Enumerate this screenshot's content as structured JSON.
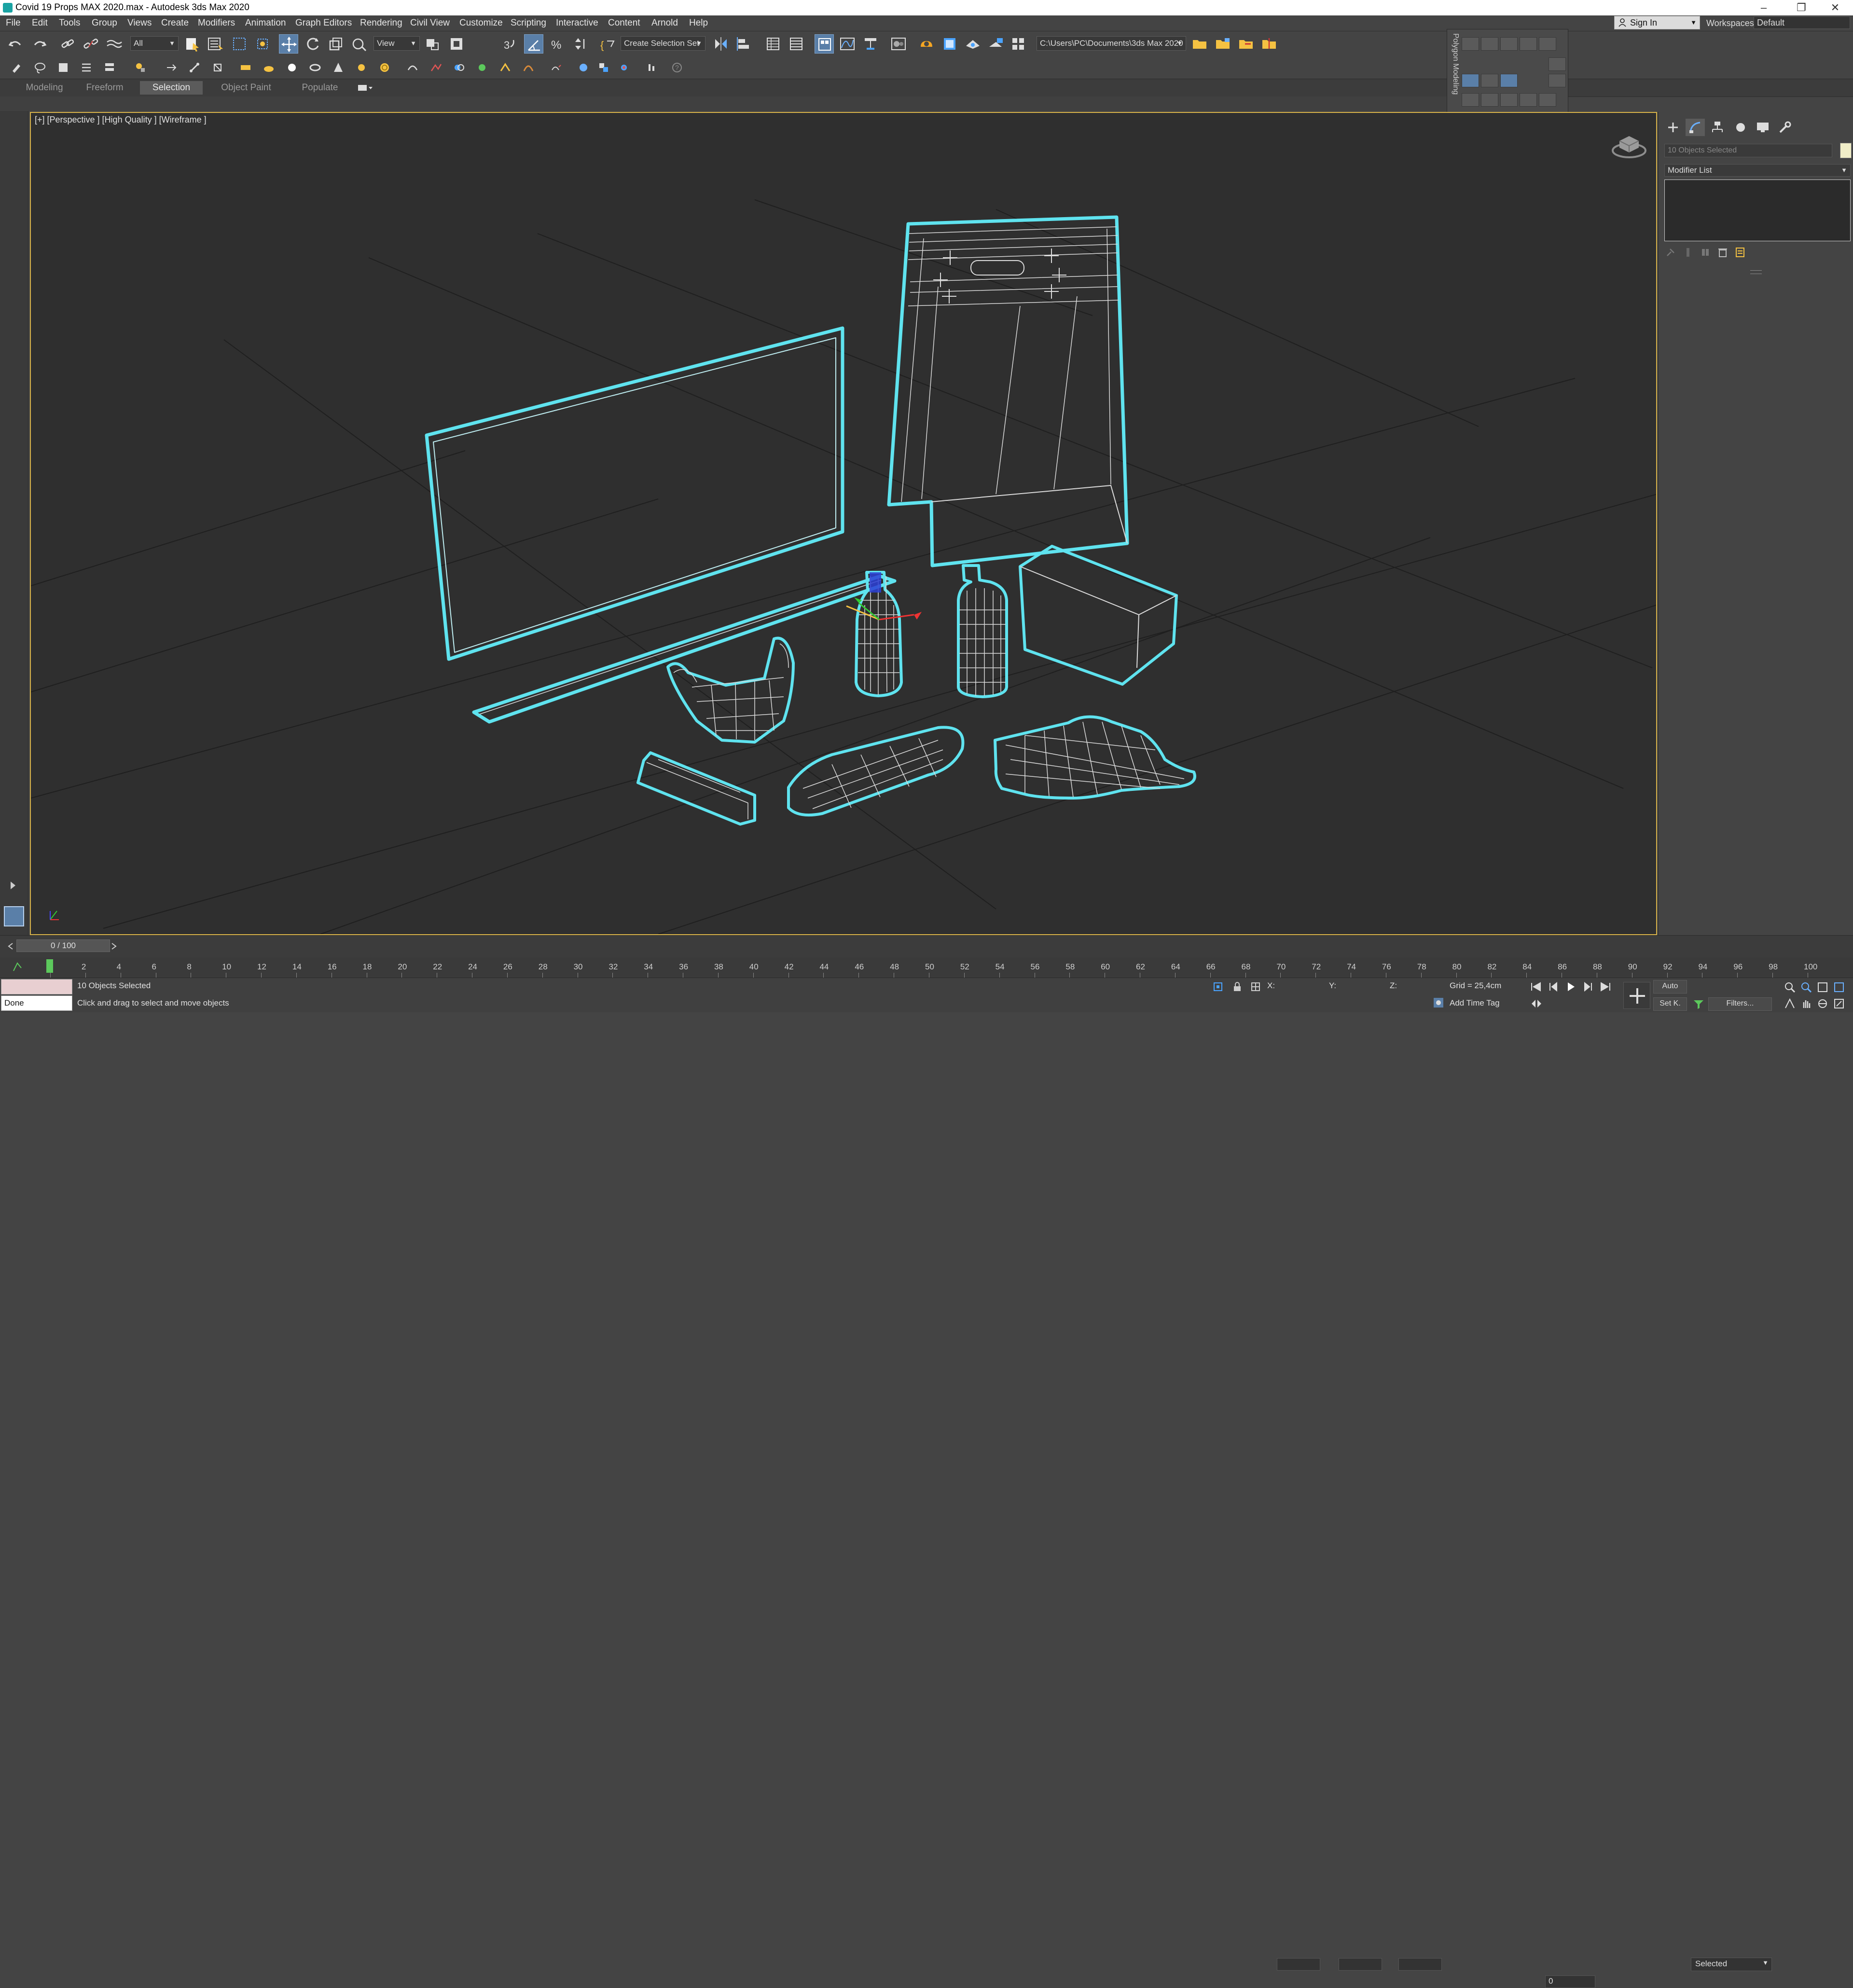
{
  "window": {
    "title": "Covid 19 Props MAX 2020.max - Autodesk 3ds Max 2020",
    "minimize": "–",
    "restore": "❐",
    "close": "✕"
  },
  "menu": [
    "File",
    "Edit",
    "Tools",
    "Group",
    "Views",
    "Create",
    "Modifiers",
    "Animation",
    "Graph Editors",
    "Rendering",
    "Civil View",
    "Customize",
    "Scripting",
    "Interactive",
    "Content",
    "Arnold",
    "Help"
  ],
  "account": {
    "sign_in": "Sign In",
    "workspaces_label": "Workspaces:",
    "workspace": "Default"
  },
  "toolbar": {
    "selection_filter": "All",
    "reference_coord": "View",
    "snap_angle": "3",
    "selection_set": "Create Selection Set",
    "project_path": "C:\\Users\\PC\\Documents\\3ds Max 2020"
  },
  "ribbon": {
    "tabs": [
      "Modeling",
      "Freeform",
      "Selection",
      "Object Paint",
      "Populate"
    ],
    "active": "Selection"
  },
  "floating_panel": {
    "label": "Polygon Modeling"
  },
  "viewport": {
    "label": "[+] [Perspective ] [High Quality ] [Wireframe ]",
    "wire_color": "#5fe3ef",
    "background": "#2f2f2f",
    "objects": [
      "monitor",
      "shopping-bag",
      "sanitizer-bottle",
      "soap-dispenser",
      "box",
      "face-mask",
      "bandage",
      "mask-flat",
      "glove"
    ]
  },
  "command_panel": {
    "selection_name": "10 Objects Selected",
    "modifier_list": "Modifier List"
  },
  "timeline": {
    "frame_display": "0 / 100",
    "ticks": [
      "0",
      "2",
      "4",
      "6",
      "8",
      "10",
      "12",
      "14",
      "16",
      "18",
      "20",
      "22",
      "24",
      "26",
      "28",
      "30",
      "32",
      "34",
      "36",
      "38",
      "40",
      "42",
      "44",
      "46",
      "48",
      "50",
      "52",
      "54",
      "56",
      "58",
      "60",
      "62",
      "64",
      "66",
      "68",
      "70",
      "72",
      "74",
      "76",
      "78",
      "80",
      "82",
      "84",
      "86",
      "88",
      "90",
      "92",
      "94",
      "96",
      "98",
      "100"
    ]
  },
  "status": {
    "maxscript": "Done",
    "selection_info": "10 Objects Selected",
    "prompt": "Click and drag to select and move objects",
    "x_label": "X:",
    "y_label": "Y:",
    "z_label": "Z:",
    "grid": "Grid = 25,4cm",
    "add_time_tag": "Add Time Tag",
    "auto_key": "Auto",
    "set_key": "Set K.",
    "key_filter": "Selected",
    "filters": "Filters...",
    "current_frame": "0"
  }
}
